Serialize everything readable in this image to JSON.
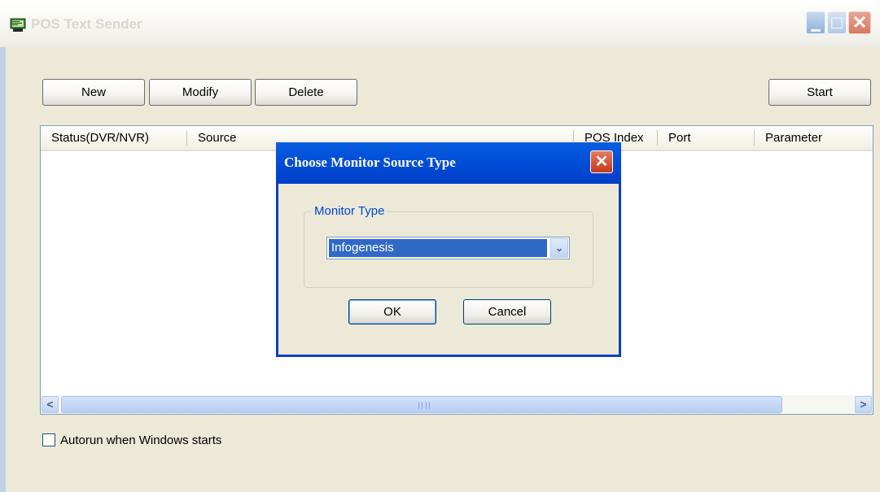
{
  "window": {
    "title": "POS Text Sender",
    "controls": {
      "minimize": "▁",
      "maximize": "□",
      "close": "✕"
    }
  },
  "toolbar": {
    "new_label": "New",
    "modify_label": "Modify",
    "delete_label": "Delete",
    "start_label": "Start"
  },
  "table": {
    "columns": [
      "Status(DVR/NVR)",
      "Source",
      "POS Index",
      "Port",
      "Parameter"
    ],
    "rows": []
  },
  "scrollbar": {
    "left_arrow": "<",
    "right_arrow": ">"
  },
  "autorun": {
    "label": "Autorun when Windows starts",
    "checked": false
  },
  "dialog": {
    "title": "Choose Monitor Source Type",
    "close_glyph": "✕",
    "group_label": "Monitor Type",
    "selected_value": "Infogenesis",
    "dropdown_arrow": "⌄",
    "ok_label": "OK",
    "cancel_label": "Cancel"
  },
  "colors": {
    "dialog_title_bar": "#0050d9",
    "selection": "#316ac5",
    "group_label": "#0046d5"
  }
}
